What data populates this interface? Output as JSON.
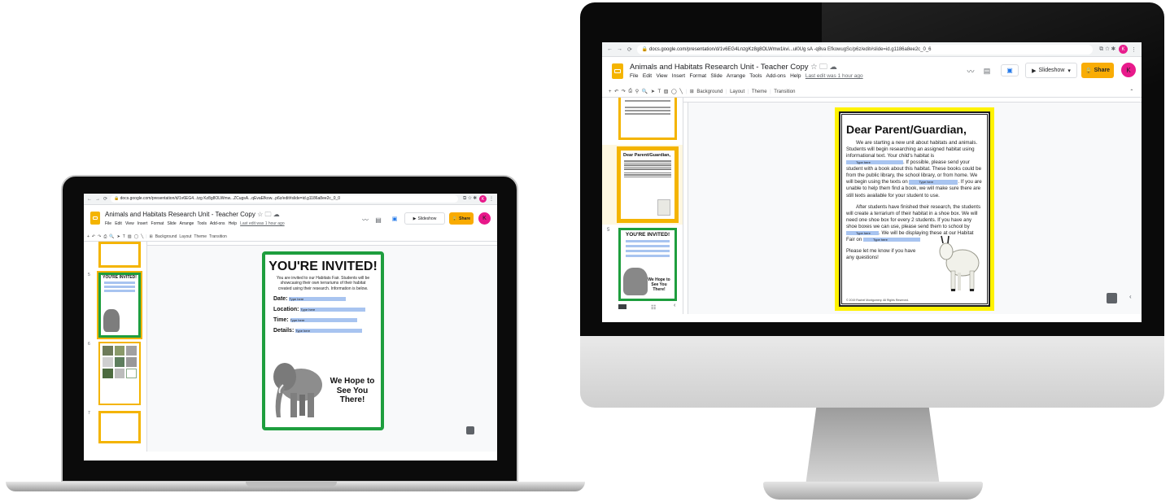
{
  "laptop": {
    "url": "docs.google.com/presentation/d/1v6EG4...tzg Kz8g8OLWmw...ZCugsA...qEvaEfkow...p6z/edit#slide=id.g1186a8ee2c_0_0",
    "doc_title": "Animals and Habitats Research Unit - Teacher Copy",
    "menu": [
      "File",
      "Edit",
      "View",
      "Insert",
      "Format",
      "Slide",
      "Arrange",
      "Tools",
      "Add-ons",
      "Help"
    ],
    "last_edit": "Last edit was 1 hour ago",
    "slideshow_label": "Slideshow",
    "share_label": "Share",
    "profile_initial": "K",
    "toolbar": [
      "Background",
      "Layout",
      "Theme",
      "Transition"
    ],
    "slide_numbers": [
      "5",
      "6",
      "7"
    ],
    "slide": {
      "title": "YOU'RE INVITED!",
      "intro": "You are invited to our Habitats Fair. Students will be showcasing their own terrariums of their habitat created using their research. Information is below.",
      "fields": [
        {
          "label": "Date:",
          "value": "Type here"
        },
        {
          "label": "Location:",
          "value": "Type here"
        },
        {
          "label": "Time:",
          "value": "Type here"
        },
        {
          "label": "Details:",
          "value": "Type here"
        }
      ],
      "closing": "We Hope to See You There!"
    }
  },
  "desktop": {
    "url": "docs.google.com/presentation/d/1v6EG4LnzgKz8g8OLWmw1kvi...ul0Ug sA -q8va EfkowugSc/p6z/edit#slide=id.g1186a8ee2c_0_6",
    "doc_title": "Animals and Habitats Research Unit - Teacher Copy",
    "menu": [
      "File",
      "Edit",
      "View",
      "Insert",
      "Format",
      "Slide",
      "Arrange",
      "Tools",
      "Add-ons",
      "Help"
    ],
    "last_edit": "Last edit was 1 hour ago",
    "slideshow_label": "Slideshow",
    "share_label": "Share",
    "profile_initial": "K",
    "toolbar": [
      "Background",
      "Layout",
      "Theme",
      "Transition"
    ],
    "slide_numbers": [
      "4",
      "5"
    ],
    "thumb_title": "Dear Parent/Guardian,",
    "thumb_invite_title": "YOU'RE INVITED!",
    "thumb_closing": "We Hope to See You There!",
    "slide": {
      "title": "Dear Parent/Guardian,",
      "para1_a": "We are starting a new unit about habitats and animals. Students will begin researching an assigned habitat using informational text. Your child's habitat is",
      "para1_field": "Type here",
      "para1_b": ". If possible, please send your student with a book about this habitat. These books could be from the public library, the school library, or from home. We will begin using the texts on",
      "para1_field2": "Type here",
      "para1_c": ". If you are unable to help them find a book, we will make sure there are still texts available for your student to use.",
      "para2_a": "After students have finished their research, the students will create a terrarium of their habitat in a shoe box. We will need one shoe box for every 2 students. If you have any shoe boxes we can use, please send them to school by",
      "para2_field": "Type here",
      "para2_b": ". We will be displaying these at our Habitat Fair on",
      "para2_field2": "Type here",
      "para3": "Please let me know if you have any questions!",
      "copyright": "© 2019 Rachel Montgomery. All Rights Reserved."
    }
  }
}
